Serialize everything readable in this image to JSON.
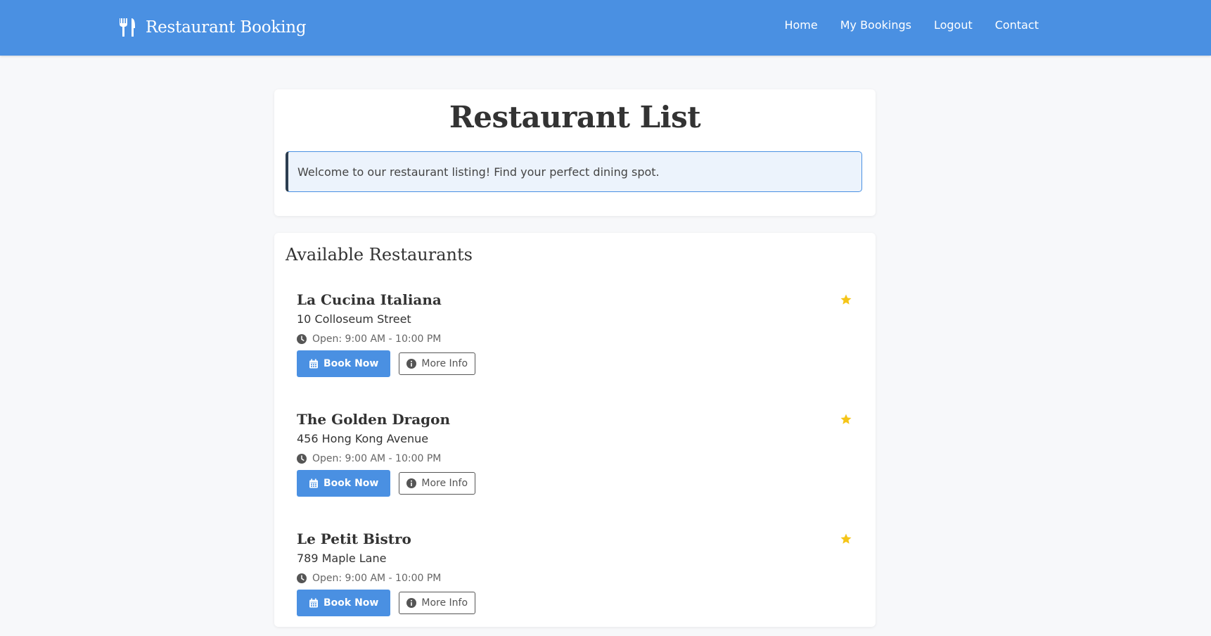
{
  "navbar": {
    "brand_icon": "utensils-icon",
    "brand": "Restaurant Booking",
    "links": [
      "Home",
      "My Bookings",
      "Logout",
      "Contact"
    ]
  },
  "header": {
    "title": "Restaurant List",
    "welcome": "Welcome to our restaurant listing! Find your perfect dining spot."
  },
  "list": {
    "title": "Available Restaurants",
    "book_label": "Book Now",
    "info_label": "More Info",
    "restaurants": [
      {
        "name": "La Cucina Italiana",
        "address": "10 Colloseum Street",
        "hours": "Open: 9:00 AM - 10:00 PM"
      },
      {
        "name": "The Golden Dragon",
        "address": "456 Hong Kong Avenue",
        "hours": "Open: 9:00 AM - 10:00 PM"
      },
      {
        "name": "Le Petit Bistro",
        "address": "789 Maple Lane",
        "hours": "Open: 9:00 AM - 10:00 PM"
      }
    ]
  },
  "icons": {
    "favorite": "star-icon",
    "hours": "clock-icon",
    "book": "calendar-icon",
    "info": "info-circle-icon"
  },
  "colors": {
    "primary": "#4a90e2",
    "star": "#f5c518",
    "alert_bg": "#ecf3fc",
    "alert_accent": "#2c3e50"
  }
}
